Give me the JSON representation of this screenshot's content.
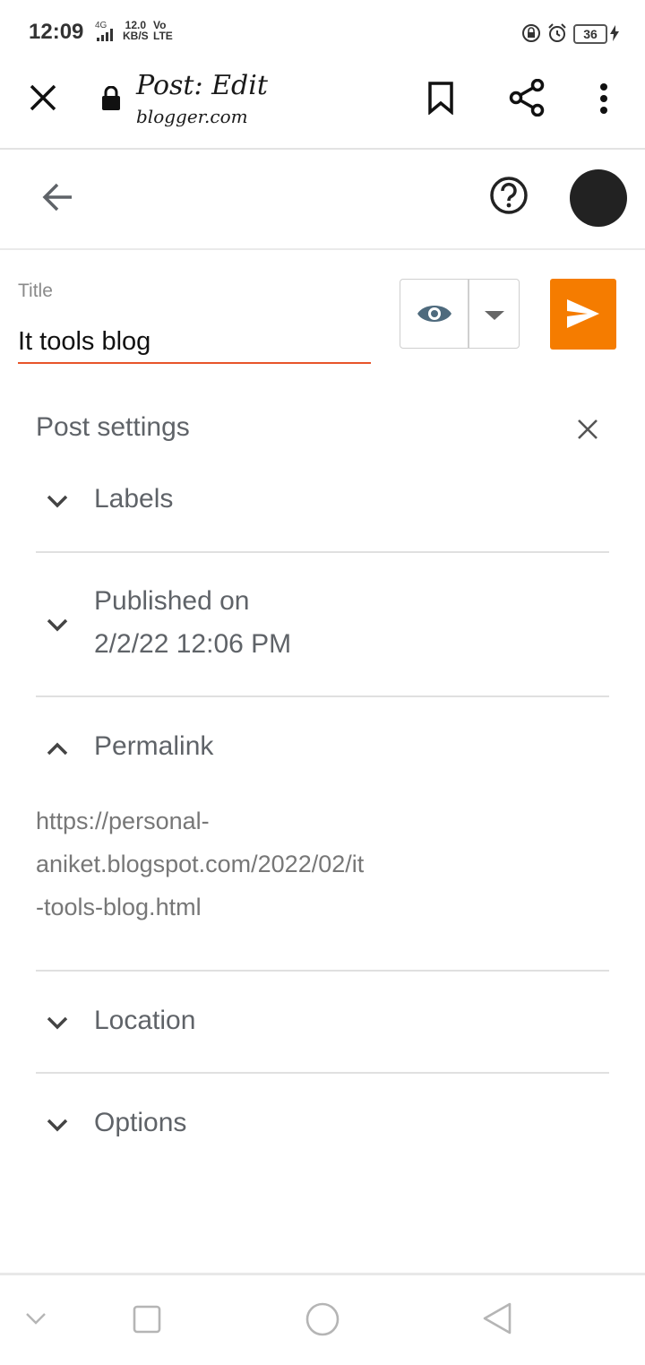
{
  "status_bar": {
    "time": "12:09",
    "network": "4G",
    "speed_value": "12.0",
    "speed_unit": "KB/S",
    "volte_top": "Vo",
    "volte_bottom": "LTE",
    "battery": "36"
  },
  "browser": {
    "title": "Post: Edit",
    "domain": "blogger.com",
    "icons": [
      "close-icon",
      "lock-icon",
      "bookmark-icon",
      "share-icon",
      "more-vert-icon"
    ]
  },
  "header": {
    "icons": [
      "back-arrow-icon",
      "help-icon",
      "avatar"
    ]
  },
  "post": {
    "title_label": "Title",
    "title_value": "It tools blog",
    "accent_color": "#f57c00"
  },
  "settings": {
    "heading": "Post settings",
    "labels": "Labels",
    "published_label": "Published on",
    "published_value": "2/2/22 12:06 PM",
    "permalink": "Permalink",
    "permalink_lines": [
      "https://personal-",
      "aniket.blogspot.com/2022/02/it",
      "-tools-blog.html"
    ],
    "location": "Location",
    "options": "Options"
  },
  "nav": {
    "icons": [
      "collapse-icon",
      "recents-icon",
      "home-icon",
      "back-icon"
    ]
  }
}
